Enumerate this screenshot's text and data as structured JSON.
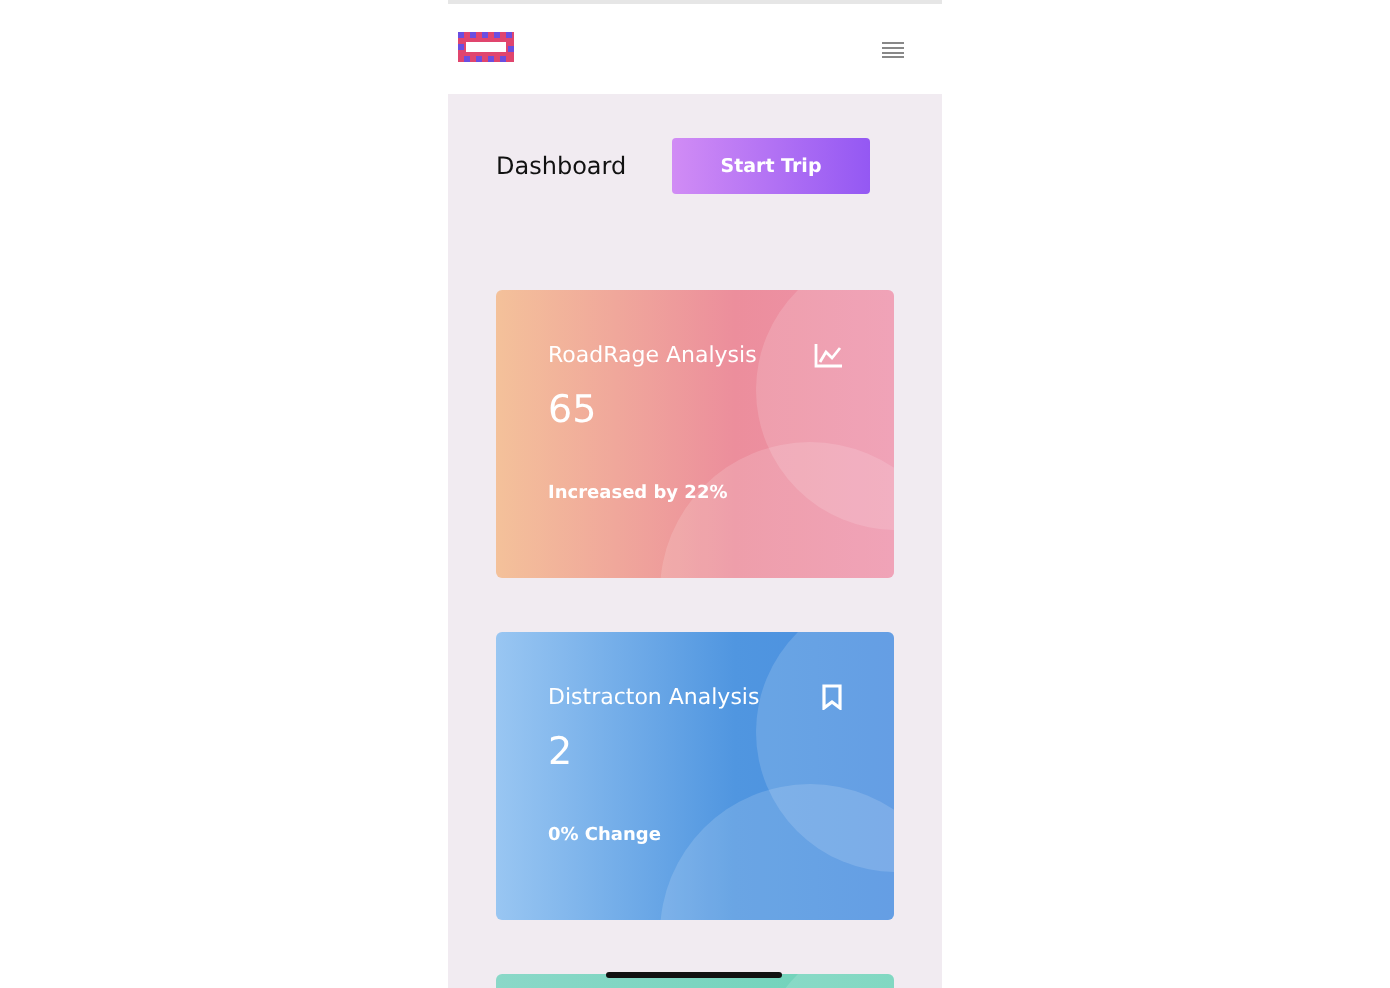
{
  "header": {
    "title": "Dashboard",
    "button": "Start Trip"
  },
  "cards": [
    {
      "kind": "chart",
      "title": "RoadRage Analysis",
      "value": "65",
      "note": "Increased by 22%"
    },
    {
      "kind": "bookmark",
      "title": "Distracton Analysis",
      "value": "2",
      "note": "0% Change"
    },
    {
      "kind": "plain"
    }
  ]
}
